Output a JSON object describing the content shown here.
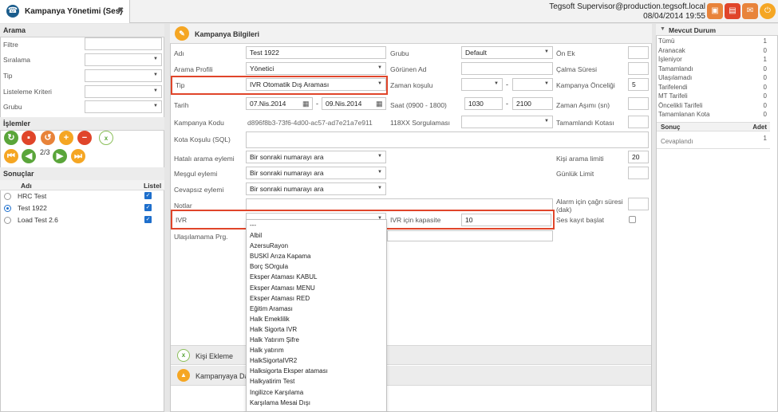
{
  "tab": {
    "title": "Kampanya Yönetimi (Ses)",
    "close": "✖"
  },
  "header": {
    "user": "Tegsoft Supervisor@production.tegsoft.local",
    "datetime": "08/04/2014 19:55"
  },
  "left": {
    "arama_title": "Arama",
    "filters": [
      {
        "label": "Filtre"
      },
      {
        "label": "Sıralama"
      },
      {
        "label": "Tip"
      },
      {
        "label": "Listeleme Kriteri"
      },
      {
        "label": "Grubu"
      }
    ],
    "islemler_title": "İşlemler",
    "pager": "2/3",
    "sonuclar_title": "Sonuçlar",
    "col_name": "Adı",
    "col_list": "Listel",
    "results": [
      {
        "name": "HRC Test"
      },
      {
        "name": "Test 1922"
      },
      {
        "name": "Load Test 2.6"
      }
    ]
  },
  "form": {
    "title": "Kampanya Bilgileri",
    "adi_label": "Adı",
    "adi_value": "Test 1922",
    "grubu_label": "Grubu",
    "grubu_value": "Default",
    "onek_label": "Ön Ek",
    "arama_profili_label": "Arama Profili",
    "arama_profili_value": "Yönetici",
    "gorunen_ad_label": "Görünen Ad",
    "calma_suresi_label": "Çalma Süresi",
    "tip_label": "Tip",
    "tip_value": "IVR Otomatik Dış Araması",
    "zaman_kosulu_label": "Zaman koşulu",
    "oncelik_label": "Kampanya Önceliği",
    "oncelik_value": "5",
    "tarih_label": "Tarih",
    "tarih_from": "07.Nis.2014",
    "tarih_to": "09.Nis.2014",
    "dash": "-",
    "saat_label": "Saat (0900 - 1800)",
    "saat_from": "1030",
    "saat_to": "2100",
    "zaman_asimi_label": "Zaman Aşımı (sn)",
    "kodu_label": "Kampanya Kodu",
    "kodu_value": "d896f8b3-73f6-4d00-ac57-ad7e21a7e911",
    "sorgulama_label": "118XX Sorgulaması",
    "tamamlandi_label": "Tamamlandı Kotası",
    "kota_label": "Kota Koşulu (SQL)",
    "hatali_label": "Hatalı arama eylemi",
    "hatali_value": "Bir sonraki numarayı ara",
    "kisi_limit_label": "Kişi arama limiti",
    "kisi_limit_value": "20",
    "mesgul_label": "Meşgul eylemi",
    "mesgul_value": "Bir sonraki numarayı ara",
    "gunluk_label": "Günlük Limit",
    "cevapsiz_label": "Cevapsız eylemi",
    "cevapsiz_value": "Bir sonraki numarayı ara",
    "notlar_label": "Notlar",
    "alarm_label": "Alarm için çağrı süresi (dak)",
    "ivr_label": "IVR",
    "kapasite_label": "IVR için kapasite",
    "kapasite_value": "10",
    "ses_kayit_label": "Ses kayıt başlat",
    "ulasilamama_label": "Ulaşılamama Prg.",
    "kisi_ekleme": "Kişi Ekleme",
    "kampanyaya_da": "Kampanyaya Da"
  },
  "ivr_options": [
    "---",
    "Albil",
    "AzersuRayon",
    "BUSKİ Arıza Kapama",
    "Borç SOrgula",
    "Eksper Ataması KABUL",
    "Eksper Ataması MENU",
    "Eksper Ataması RED",
    "Eğitim Araması",
    "Halk Emeklilik",
    "Halk Sigorta IVR",
    "Halk Yatırım Şifre",
    "Halk yatırım",
    "HalkSigortaIVR2",
    "Halksigorta Eksper ataması",
    "Halkyatirim Test",
    "Ingilizce Karşılama",
    "Karşılama Mesai Dışı"
  ],
  "status": {
    "title": "Mevcut Durum",
    "rows": [
      {
        "label": "Tümü",
        "value": "1"
      },
      {
        "label": "Aranacak",
        "value": "0"
      },
      {
        "label": "İşleniyor",
        "value": "1"
      },
      {
        "label": "Tamamlandı",
        "value": "0"
      },
      {
        "label": "Ulaşılamadı",
        "value": "0"
      },
      {
        "label": "Tarifelendi",
        "value": "0"
      },
      {
        "label": "MT Tarifeli",
        "value": "0"
      },
      {
        "label": "Öncelikli Tarifeli",
        "value": "0"
      },
      {
        "label": "Tamamlanan Kota",
        "value": "0"
      }
    ],
    "sonuc_label": "Sonuç",
    "adet_label": "Adet",
    "sonuc_rows": [
      {
        "label": "Cevaplandı",
        "value": "1"
      }
    ]
  },
  "colors": {
    "accent": "#e0452a",
    "brand": "#1a5c8c"
  }
}
